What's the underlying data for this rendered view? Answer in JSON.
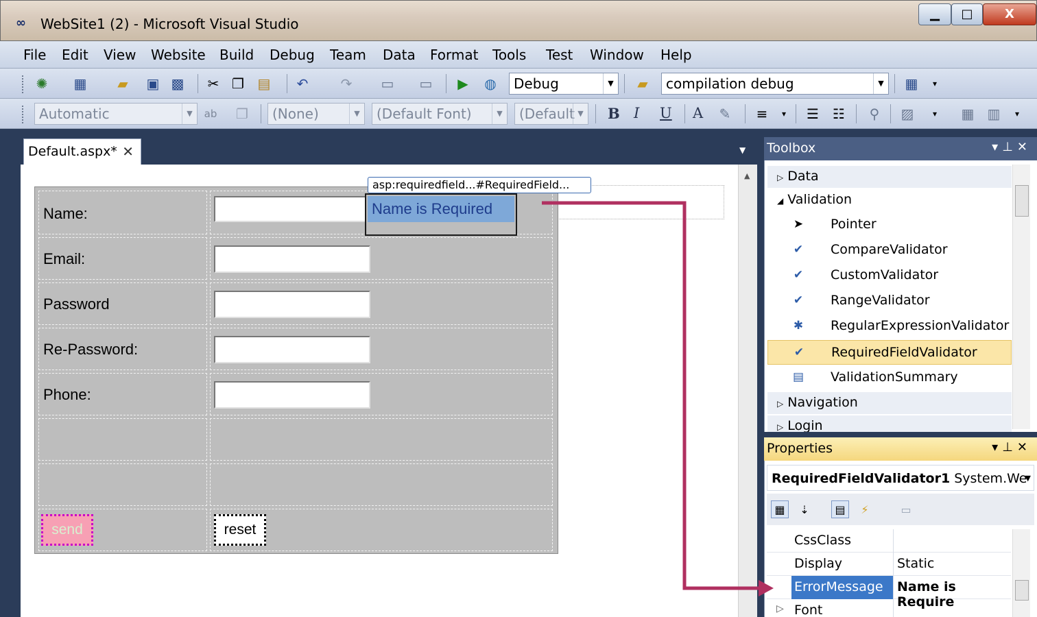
{
  "window": {
    "title": "WebSite1 (2) - Microsoft Visual Studio",
    "min_glyph": "▁",
    "max_glyph": "□",
    "close_glyph": "X"
  },
  "menu": [
    "File",
    "Edit",
    "View",
    "Website",
    "Build",
    "Debug",
    "Team",
    "Data",
    "Format",
    "Tools",
    "Test",
    "Window",
    "Help"
  ],
  "toolbar1": {
    "config_value": "Debug",
    "target_value": "compilation debug"
  },
  "toolbar2": {
    "block_format": "Automatic",
    "css_class": "(None)",
    "font": "(Default Font)",
    "font_size": "(Default"
  },
  "document": {
    "tab_label": "Default.aspx*",
    "tab_close": "✕",
    "form_labels": [
      "Name:",
      "Email:",
      "Password",
      "Re-Password:",
      "Phone:"
    ],
    "send_label": "send",
    "reset_label": "reset",
    "validator_tag": "asp:requiredfield...#RequiredField...",
    "validator_text": "Name is Required"
  },
  "toolbox": {
    "title": "Toolbox",
    "categories_top": [
      "Data",
      "Validation"
    ],
    "items": [
      {
        "label": "Pointer",
        "icon": "pointer-icon",
        "glyph": "➤"
      },
      {
        "label": "CompareValidator",
        "icon": "compare-validator-icon",
        "glyph": "✔"
      },
      {
        "label": "CustomValidator",
        "icon": "custom-validator-icon",
        "glyph": "✔"
      },
      {
        "label": "RangeValidator",
        "icon": "range-validator-icon",
        "glyph": "✔"
      },
      {
        "label": "RegularExpressionValidator",
        "icon": "regex-validator-icon",
        "glyph": "✱"
      },
      {
        "label": "RequiredFieldValidator",
        "icon": "required-field-validator-icon",
        "glyph": "✔"
      },
      {
        "label": "ValidationSummary",
        "icon": "validation-summary-icon",
        "glyph": "▤"
      }
    ],
    "selected_item": "RequiredFieldValidator",
    "categories_bottom": [
      "Navigation",
      "Login"
    ]
  },
  "properties": {
    "title": "Properties",
    "object_name": "RequiredFieldValidator1",
    "object_type": "System.We",
    "rows": [
      {
        "name": "CssClass",
        "value": ""
      },
      {
        "name": "Display",
        "value": "Static"
      },
      {
        "name": "ErrorMessage",
        "value": "Name is Require"
      },
      {
        "name": "Font",
        "value": ""
      }
    ],
    "selected_row": "ErrorMessage"
  },
  "colors": {
    "panel_header": "#4b5f84",
    "properties_header": "#f5d77e",
    "selection_blue": "#3b78c8",
    "arrow": "#b03060"
  }
}
